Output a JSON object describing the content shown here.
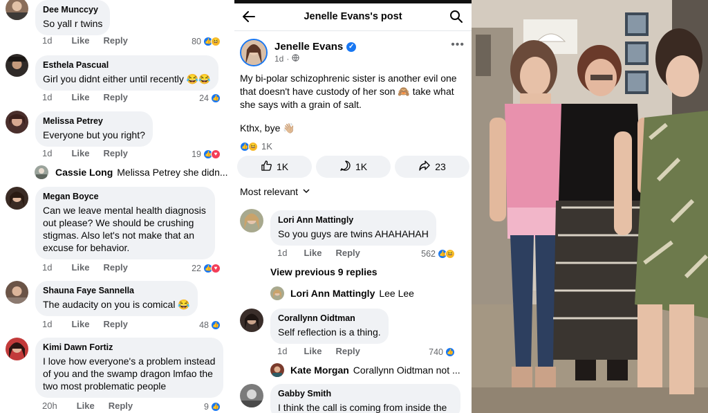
{
  "left_comments": [
    {
      "name": "Dee Munccyy",
      "text": "So yall r twins",
      "time": "1d",
      "like": "Like",
      "reply": "Reply",
      "count": "80",
      "reactions": [
        "like",
        "haha"
      ]
    },
    {
      "name": "Esthela Pascual",
      "text": "Girl you didnt either until recently 😂😂",
      "time": "1d",
      "like": "Like",
      "reply": "Reply",
      "count": "24",
      "reactions": [
        "like"
      ]
    },
    {
      "name": "Melissa Petrey",
      "text": "Everyone but you right?",
      "time": "1d",
      "like": "Like",
      "reply": "Reply",
      "count": "19",
      "reactions": [
        "like",
        "heart"
      ]
    },
    {
      "name": "Megan Boyce",
      "text_lines": [
        "Can we leave mental health diagnosis",
        "out please? We should be crushing",
        "stigmas. Also let's not make that an",
        "excuse for behavior."
      ],
      "time": "1d",
      "like": "Like",
      "reply": "Reply",
      "count": "22",
      "reactions": [
        "like",
        "heart"
      ]
    },
    {
      "name": "Shauna Faye Sannella",
      "text": "The audacity on you is comical 😂",
      "time": "1d",
      "like": "Like",
      "reply": "Reply",
      "count": "48",
      "reactions": [
        "like"
      ]
    },
    {
      "name": "Kimi Dawn Fortiz",
      "text_lines": [
        "I love how everyone's a problem instead",
        "of you and the swamp dragon lmfao the",
        "two most problematic people"
      ],
      "time": "20h",
      "like": "Like",
      "reply": "Reply",
      "count": "9",
      "reactions": [
        "like"
      ]
    }
  ],
  "left_reply_preview": {
    "name": "Cassie Long",
    "text": "Melissa Petrey she didn..."
  },
  "post": {
    "header_title": "Jenelle Evans's post",
    "author": "Jenelle Evans",
    "time": "1d",
    "text_lines": [
      "My bi-polar schizophrenic sister is another evil one",
      "that doesn't have custody of her son 🙈 take what",
      "she says with a grain of salt."
    ],
    "sign_off": "Kthx, bye 👋🏼",
    "reaction_count": "1K",
    "like_count": "1K",
    "comment_count": "1K",
    "share_count": "23",
    "sort_label": "Most relevant"
  },
  "mid_comments": [
    {
      "name": "Lori Ann Mattingly",
      "text": "So you guys are twins AHAHAHAH",
      "time": "1d",
      "like": "Like",
      "reply": "Reply",
      "count": "562",
      "reactions": [
        "like",
        "haha"
      ]
    },
    {
      "name": "Corallynn Oidtman",
      "text": "Self reflection is a thing.",
      "time": "1d",
      "like": "Like",
      "reply": "Reply",
      "count": "740",
      "reactions": [
        "like"
      ]
    },
    {
      "name": "Gabby Smith",
      "text": "I think the call is coming from inside the"
    }
  ],
  "mid_view_previous": "View previous 9 replies",
  "mid_reply_previews": [
    {
      "name": "Lori Ann Mattingly",
      "text": "Lee Lee"
    },
    {
      "name": "Kate Morgan",
      "text": "Corallynn Oidtman not ..."
    }
  ],
  "colors": {
    "facebook_blue": "#1877f2",
    "bubble_gray": "#f0f2f5",
    "meta_gray": "#65676b",
    "heart_red": "#f33e58",
    "haha_yellow": "#f7b928"
  }
}
